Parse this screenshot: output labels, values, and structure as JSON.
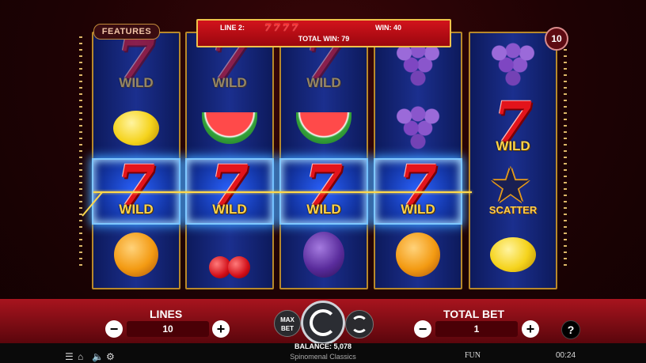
{
  "win_banner": {
    "line_label": "LINE 2:",
    "win_label": "WIN: 40",
    "total_win_label": "TOTAL WIN: 79",
    "line_symbol": "7",
    "line_symbol_count": 4
  },
  "features_button": "FEATURES",
  "lines_counter_badge": "10",
  "reels": [
    [
      {
        "s": "seven",
        "wild": "WILD",
        "dim": true
      },
      {
        "s": "lemon"
      },
      {
        "s": "seven",
        "wild": "WILD",
        "hl": true
      },
      {
        "s": "orange"
      }
    ],
    [
      {
        "s": "seven",
        "wild": "WILD",
        "dim": true
      },
      {
        "s": "melon"
      },
      {
        "s": "seven",
        "wild": "WILD",
        "hl": true
      },
      {
        "s": "cherry"
      }
    ],
    [
      {
        "s": "seven",
        "wild": "WILD",
        "dim": true
      },
      {
        "s": "melon"
      },
      {
        "s": "seven",
        "wild": "WILD",
        "hl": true
      },
      {
        "s": "plum"
      }
    ],
    [
      {
        "s": "grapes"
      },
      {
        "s": "grapes"
      },
      {
        "s": "seven",
        "wild": "WILD",
        "hl": true
      },
      {
        "s": "orange"
      }
    ],
    [
      {
        "s": "grapes"
      },
      {
        "s": "seven",
        "wild": "WILD"
      },
      {
        "s": "scatter",
        "label": "SCATTER"
      },
      {
        "s": "lemon"
      }
    ]
  ],
  "controls": {
    "lines_title": "LINES",
    "lines_value": "10",
    "total_bet_title": "TOTAL BET",
    "total_bet_value": "1",
    "minus": "−",
    "plus": "+",
    "max_bet_line1": "MAX",
    "max_bet_line2": "BET",
    "help": "?"
  },
  "footer": {
    "balance": "BALANCE: 5,078",
    "provider": "Spinomenal Classics",
    "mode": "FUN",
    "time": "00:24",
    "icons": [
      "menu-icon",
      "home-icon",
      "sound-icon",
      "settings-icon"
    ]
  },
  "colors": {
    "accent_gold": "#f0c24a",
    "reel_blue": "#1b2f8e",
    "banner_red": "#d2131c"
  }
}
